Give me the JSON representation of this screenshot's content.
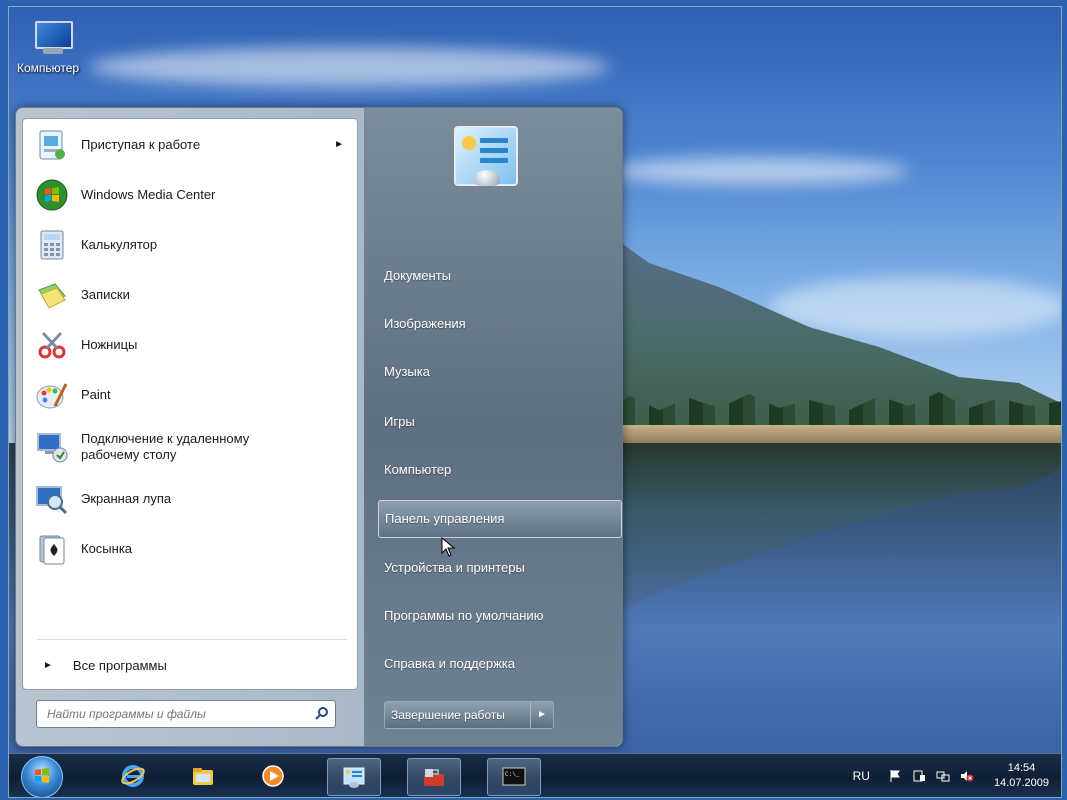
{
  "desktop": {
    "icon_label": "Компьютер"
  },
  "start_menu": {
    "programs": [
      {
        "label": "Приступая к работе",
        "icon": "getting-started-icon",
        "has_submenu": true
      },
      {
        "label": "Windows Media Center",
        "icon": "media-center-icon"
      },
      {
        "label": "Калькулятор",
        "icon": "calculator-icon"
      },
      {
        "label": "Записки",
        "icon": "sticky-notes-icon"
      },
      {
        "label": "Ножницы",
        "icon": "snipping-tool-icon"
      },
      {
        "label": "Paint",
        "icon": "paint-icon"
      },
      {
        "label": "Подключение к удаленному рабочему столу",
        "line1": "Подключение к удаленному",
        "line2": "рабочему столу",
        "icon": "remote-desktop-icon"
      },
      {
        "label": "Экранная лупа",
        "icon": "magnifier-icon"
      },
      {
        "label": "Косынка",
        "icon": "solitaire-icon"
      }
    ],
    "all_programs": "Все программы",
    "search_placeholder": "Найти программы и файлы",
    "right_items": [
      {
        "label": "Документы"
      },
      {
        "label": "Изображения"
      },
      {
        "label": "Музыка"
      },
      {
        "label": "Игры"
      },
      {
        "label": "Компьютер"
      },
      {
        "label": "Панель управления",
        "highlighted": true
      },
      {
        "label": "Устройства и принтеры"
      },
      {
        "label": "Программы по умолчанию"
      },
      {
        "label": "Справка и поддержка"
      }
    ],
    "shutdown_label": "Завершение работы"
  },
  "taskbar": {
    "pinned": [
      "internet-explorer-icon",
      "explorer-folder-icon",
      "media-player-icon",
      "control-panel-icon",
      "toolbox-icon",
      "command-prompt-icon"
    ],
    "language": "RU",
    "time": "14:54",
    "date": "14.07.2009"
  },
  "colors": {
    "accent": "#3a89d4",
    "taskbar": "#0f1e33",
    "menu_right": "#5e6f80"
  }
}
